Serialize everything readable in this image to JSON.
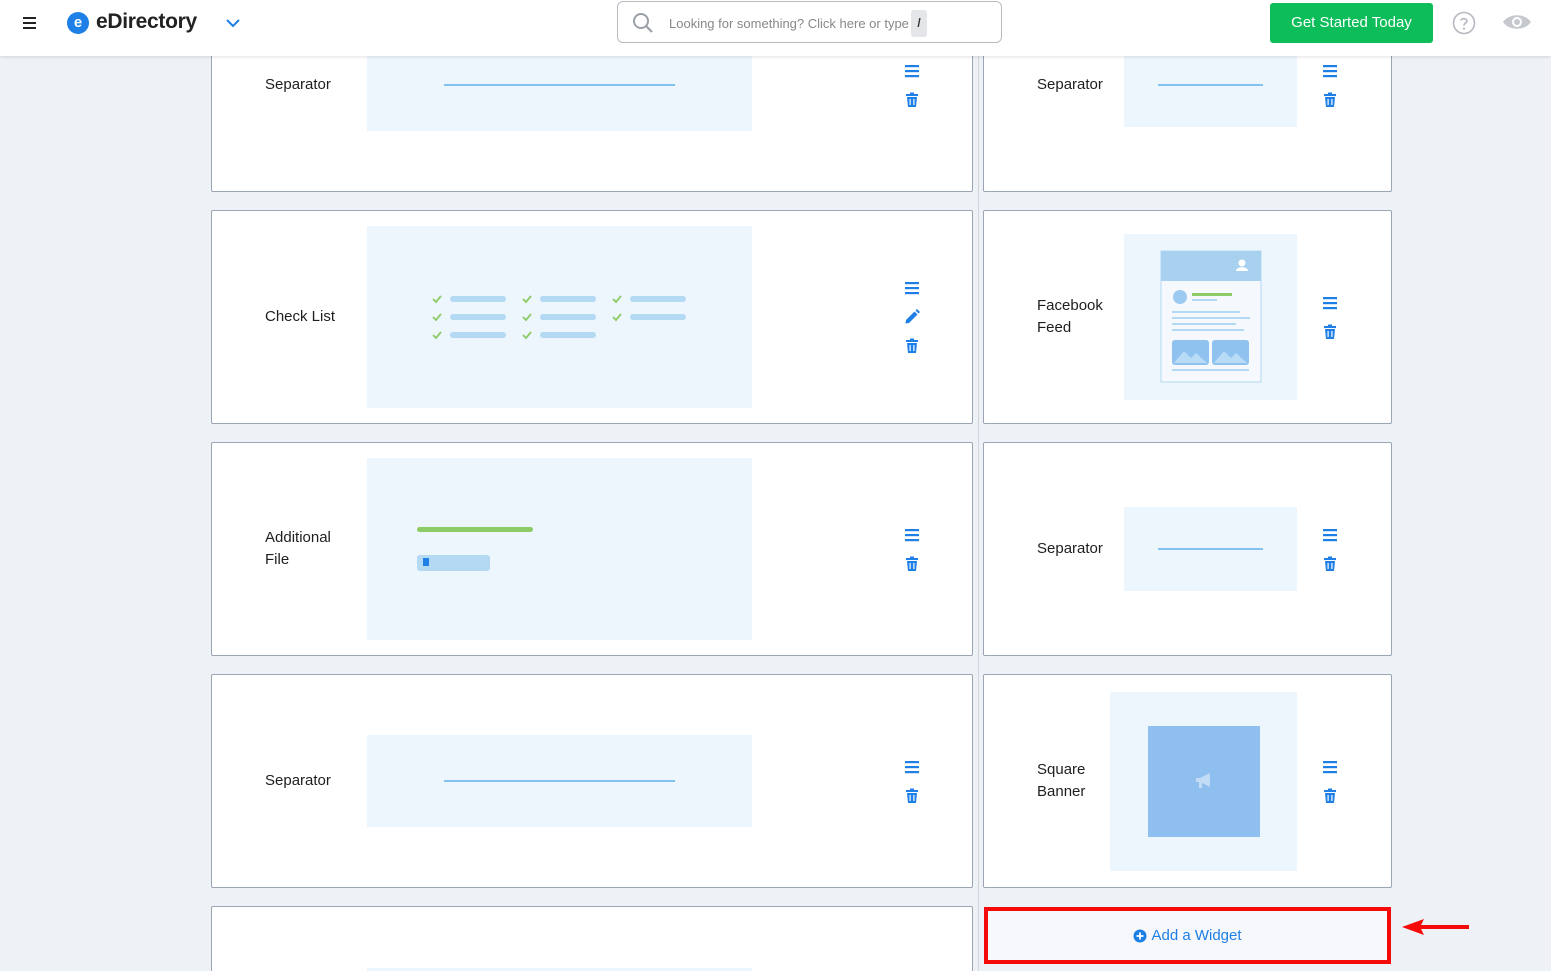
{
  "header": {
    "logo_letter": "e",
    "logo_text": "eDirectory",
    "search_placeholder": "Looking for something? Click here or type",
    "search_shortcut": "/",
    "cta_label": "Get Started Today",
    "brand_color": "#1e7fe6",
    "cta_color": "#0cbd5a"
  },
  "left_column": {
    "widgets": [
      {
        "label": "Separator"
      },
      {
        "label": "Check List"
      },
      {
        "label": "Additional File"
      },
      {
        "label": "Separator"
      }
    ]
  },
  "right_column": {
    "widgets": [
      {
        "label": "Separator"
      },
      {
        "label": "Facebook Feed"
      },
      {
        "label": "Separator"
      },
      {
        "label": "Square Banner"
      }
    ],
    "add_widget_label": "Add a Widget"
  },
  "icons": {
    "reorder": "reorder-icon",
    "edit": "pencil-icon",
    "delete": "trash-icon",
    "help": "help-icon",
    "preview": "eye-icon"
  },
  "highlight_color": "#f50a0a"
}
